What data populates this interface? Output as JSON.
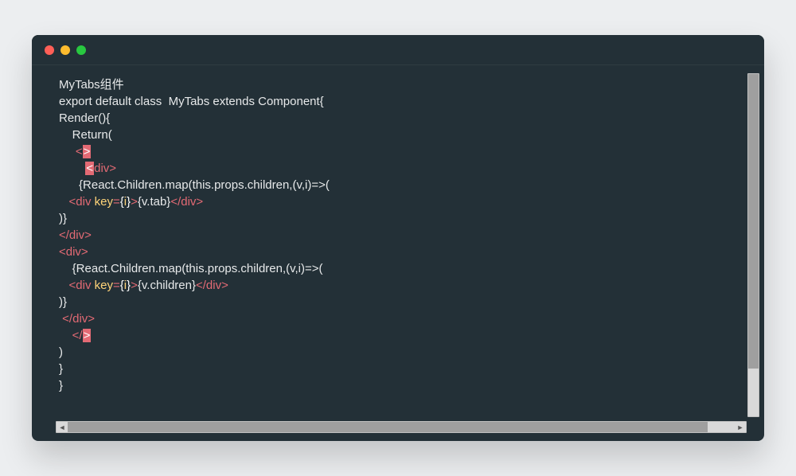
{
  "colors": {
    "bg": "#233037",
    "text": "#e7e9ea",
    "tag": "#e36a74",
    "attr": "#ffd479",
    "highlight_bg": "#e36a74"
  },
  "traffic_lights": [
    "red",
    "yellow",
    "green"
  ],
  "code": {
    "l1": "MyTabs组件",
    "l2": "export default class  MyTabs extends Component{",
    "l3": "Render(){",
    "l4_indent": "    ",
    "l4": "Return(",
    "l5_indent": "     ",
    "l5_open": "<",
    "l5_hl": ">",
    "l6_indent": "        ",
    "l6_hl": "<",
    "l6_rest": "div>",
    "l7_indent": "      ",
    "l7": "{React.Children.map(this.props.children,(v,i)=>(",
    "l8_indent": "   ",
    "l8_open": "<div",
    "l8_sp": " ",
    "l8_attr": "key",
    "l8_eq": "=",
    "l8_lb": "{",
    "l8_i": "i",
    "l8_rb": "}",
    "l8_gt": ">",
    "l8_content": "{v.tab}",
    "l8_close": "</div>",
    "l9": ")}",
    "l10": "</div>",
    "l11": "<div>",
    "l12_indent": "    ",
    "l12": "{React.Children.map(this.props.children,(v,i)=>(",
    "l13_indent": "   ",
    "l13_open": "<div",
    "l13_sp": " ",
    "l13_attr": "key",
    "l13_eq": "=",
    "l13_lb": "{",
    "l13_i": "i",
    "l13_rb": "}",
    "l13_gt": ">",
    "l13_content": "{v.children}",
    "l13_close": "</div>",
    "l14": ")}",
    "l15_indent": " ",
    "l15": "</div>",
    "l16_indent": "    ",
    "l16_open": "</",
    "l16_hl": ">",
    "l17": ")",
    "l18": "}",
    "l19": "}"
  },
  "scroll_arrows": {
    "left": "◄",
    "right": "►"
  }
}
